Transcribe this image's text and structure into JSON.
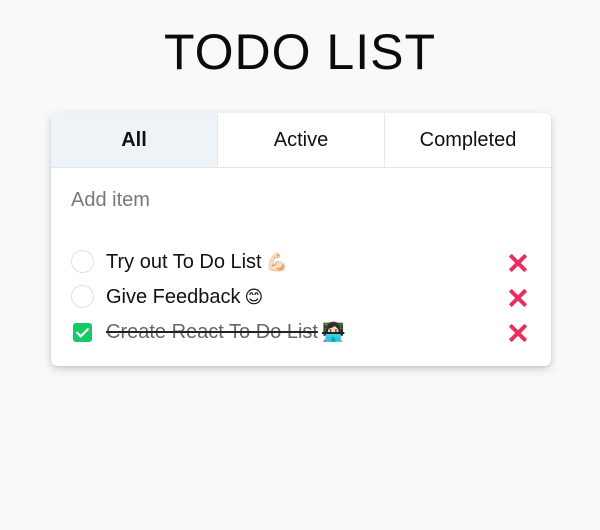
{
  "app": {
    "title": "TODO LIST"
  },
  "tabs": [
    {
      "label": "All",
      "active": true
    },
    {
      "label": "Active",
      "active": false
    },
    {
      "label": "Completed",
      "active": false
    }
  ],
  "add_item": {
    "placeholder": "Add item",
    "value": ""
  },
  "items": [
    {
      "text": "Try out To Do List",
      "emoji": "💪🏻",
      "completed": false
    },
    {
      "text": "Give Feedback",
      "emoji": "😊",
      "completed": false
    },
    {
      "text": "Create React To Do List",
      "emoji": "👩🏻‍💻",
      "completed": true
    }
  ],
  "colors": {
    "background": "#f9f9f9",
    "active_tab": "#eef3f8",
    "checked": "#17c964",
    "delete": "#e8305f"
  },
  "icons": {
    "checkbox_checked": "check-icon",
    "delete": "close-icon"
  }
}
